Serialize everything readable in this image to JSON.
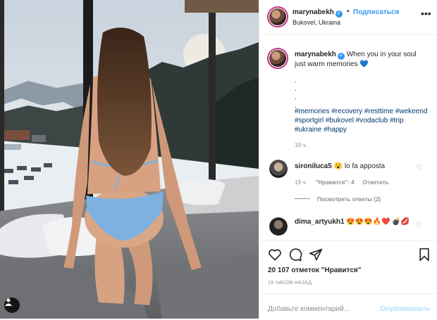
{
  "header": {
    "username": "marynabekh",
    "dot": "•",
    "follow_label": "Подписаться",
    "location": "Bukovel, Ukraina",
    "more": "•••"
  },
  "caption": {
    "username": "marynabekh",
    "text": "When you in your soul just warm memories 💙",
    "dots": [
      ".",
      ".",
      ".",
      "."
    ],
    "hashtags": "#memories #recovery #resttime #wekeend #sportgirl #bukovel #vodaclub #trip #ukraine #happy",
    "time": "19 ч."
  },
  "comments": [
    {
      "username": "sironiluca5",
      "text": "😮 lo fa apposta",
      "time": "19 ч.",
      "likes": "\"Нравится\": 4",
      "reply": "Ответить"
    },
    {
      "username": "dima_artyukh1",
      "text": "😍😍😍🔥❤️ 💣💋"
    }
  ],
  "view_replies": "Посмотреть ответы (2)",
  "actions": {
    "icons": [
      "heart-icon",
      "comment-icon",
      "share-icon",
      "bookmark-icon"
    ],
    "likes_count": "20 107",
    "likes_word": "отметок",
    "likes_label": "\"Нравится\"",
    "posted": "19 ЧАСОВ НАЗАД"
  },
  "add_comment": {
    "placeholder": "Добавьте комментарий...",
    "publish_label": "Опубликовать"
  },
  "colors": {
    "link_blue": "#3897f0",
    "hashtag": "#00376b",
    "muted": "#8e8e8e",
    "publish_disabled": "#b2dffc",
    "story_ring": "#c13584"
  }
}
